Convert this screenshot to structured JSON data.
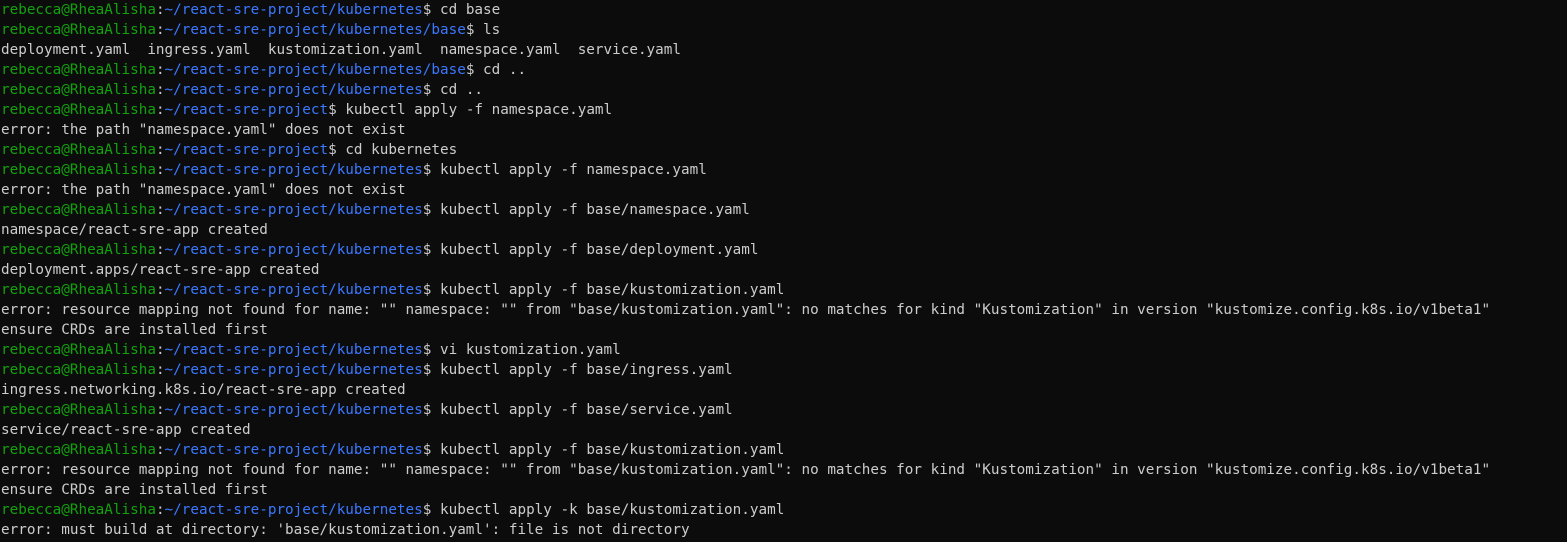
{
  "terminal": {
    "lines": [
      {
        "type": "prompt",
        "user": "rebecca@RheaAlisha",
        "path": "~/react-sre-project/kubernetes",
        "cmd": "cd base"
      },
      {
        "type": "prompt",
        "user": "rebecca@RheaAlisha",
        "path": "~/react-sre-project/kubernetes/base",
        "cmd": "ls"
      },
      {
        "type": "output",
        "text": "deployment.yaml  ingress.yaml  kustomization.yaml  namespace.yaml  service.yaml"
      },
      {
        "type": "prompt",
        "user": "rebecca@RheaAlisha",
        "path": "~/react-sre-project/kubernetes/base",
        "cmd": "cd .."
      },
      {
        "type": "prompt",
        "user": "rebecca@RheaAlisha",
        "path": "~/react-sre-project/kubernetes",
        "cmd": "cd .."
      },
      {
        "type": "prompt",
        "user": "rebecca@RheaAlisha",
        "path": "~/react-sre-project",
        "cmd": "kubectl apply -f namespace.yaml"
      },
      {
        "type": "output",
        "text": "error: the path \"namespace.yaml\" does not exist"
      },
      {
        "type": "prompt",
        "user": "rebecca@RheaAlisha",
        "path": "~/react-sre-project",
        "cmd": "cd kubernetes"
      },
      {
        "type": "prompt",
        "user": "rebecca@RheaAlisha",
        "path": "~/react-sre-project/kubernetes",
        "cmd": "kubectl apply -f namespace.yaml"
      },
      {
        "type": "output",
        "text": "error: the path \"namespace.yaml\" does not exist"
      },
      {
        "type": "prompt",
        "user": "rebecca@RheaAlisha",
        "path": "~/react-sre-project/kubernetes",
        "cmd": "kubectl apply -f base/namespace.yaml"
      },
      {
        "type": "output",
        "text": "namespace/react-sre-app created"
      },
      {
        "type": "prompt",
        "user": "rebecca@RheaAlisha",
        "path": "~/react-sre-project/kubernetes",
        "cmd": "kubectl apply -f base/deployment.yaml"
      },
      {
        "type": "output",
        "text": "deployment.apps/react-sre-app created"
      },
      {
        "type": "prompt",
        "user": "rebecca@RheaAlisha",
        "path": "~/react-sre-project/kubernetes",
        "cmd": "kubectl apply -f base/kustomization.yaml"
      },
      {
        "type": "output",
        "text": "error: resource mapping not found for name: \"\" namespace: \"\" from \"base/kustomization.yaml\": no matches for kind \"Kustomization\" in version \"kustomize.config.k8s.io/v1beta1\""
      },
      {
        "type": "output",
        "text": "ensure CRDs are installed first"
      },
      {
        "type": "prompt",
        "user": "rebecca@RheaAlisha",
        "path": "~/react-sre-project/kubernetes",
        "cmd": "vi kustomization.yaml"
      },
      {
        "type": "prompt",
        "user": "rebecca@RheaAlisha",
        "path": "~/react-sre-project/kubernetes",
        "cmd": "kubectl apply -f base/ingress.yaml"
      },
      {
        "type": "output",
        "text": "ingress.networking.k8s.io/react-sre-app created"
      },
      {
        "type": "prompt",
        "user": "rebecca@RheaAlisha",
        "path": "~/react-sre-project/kubernetes",
        "cmd": "kubectl apply -f base/service.yaml"
      },
      {
        "type": "output",
        "text": "service/react-sre-app created"
      },
      {
        "type": "prompt",
        "user": "rebecca@RheaAlisha",
        "path": "~/react-sre-project/kubernetes",
        "cmd": "kubectl apply -f base/kustomization.yaml"
      },
      {
        "type": "output",
        "text": "error: resource mapping not found for name: \"\" namespace: \"\" from \"base/kustomization.yaml\": no matches for kind \"Kustomization\" in version \"kustomize.config.k8s.io/v1beta1\""
      },
      {
        "type": "output",
        "text": "ensure CRDs are installed first"
      },
      {
        "type": "prompt",
        "user": "rebecca@RheaAlisha",
        "path": "~/react-sre-project/kubernetes",
        "cmd": "kubectl apply -k base/kustomization.yaml"
      },
      {
        "type": "output",
        "text": "error: must build at directory: 'base/kustomization.yaml': file is not directory"
      }
    ]
  }
}
